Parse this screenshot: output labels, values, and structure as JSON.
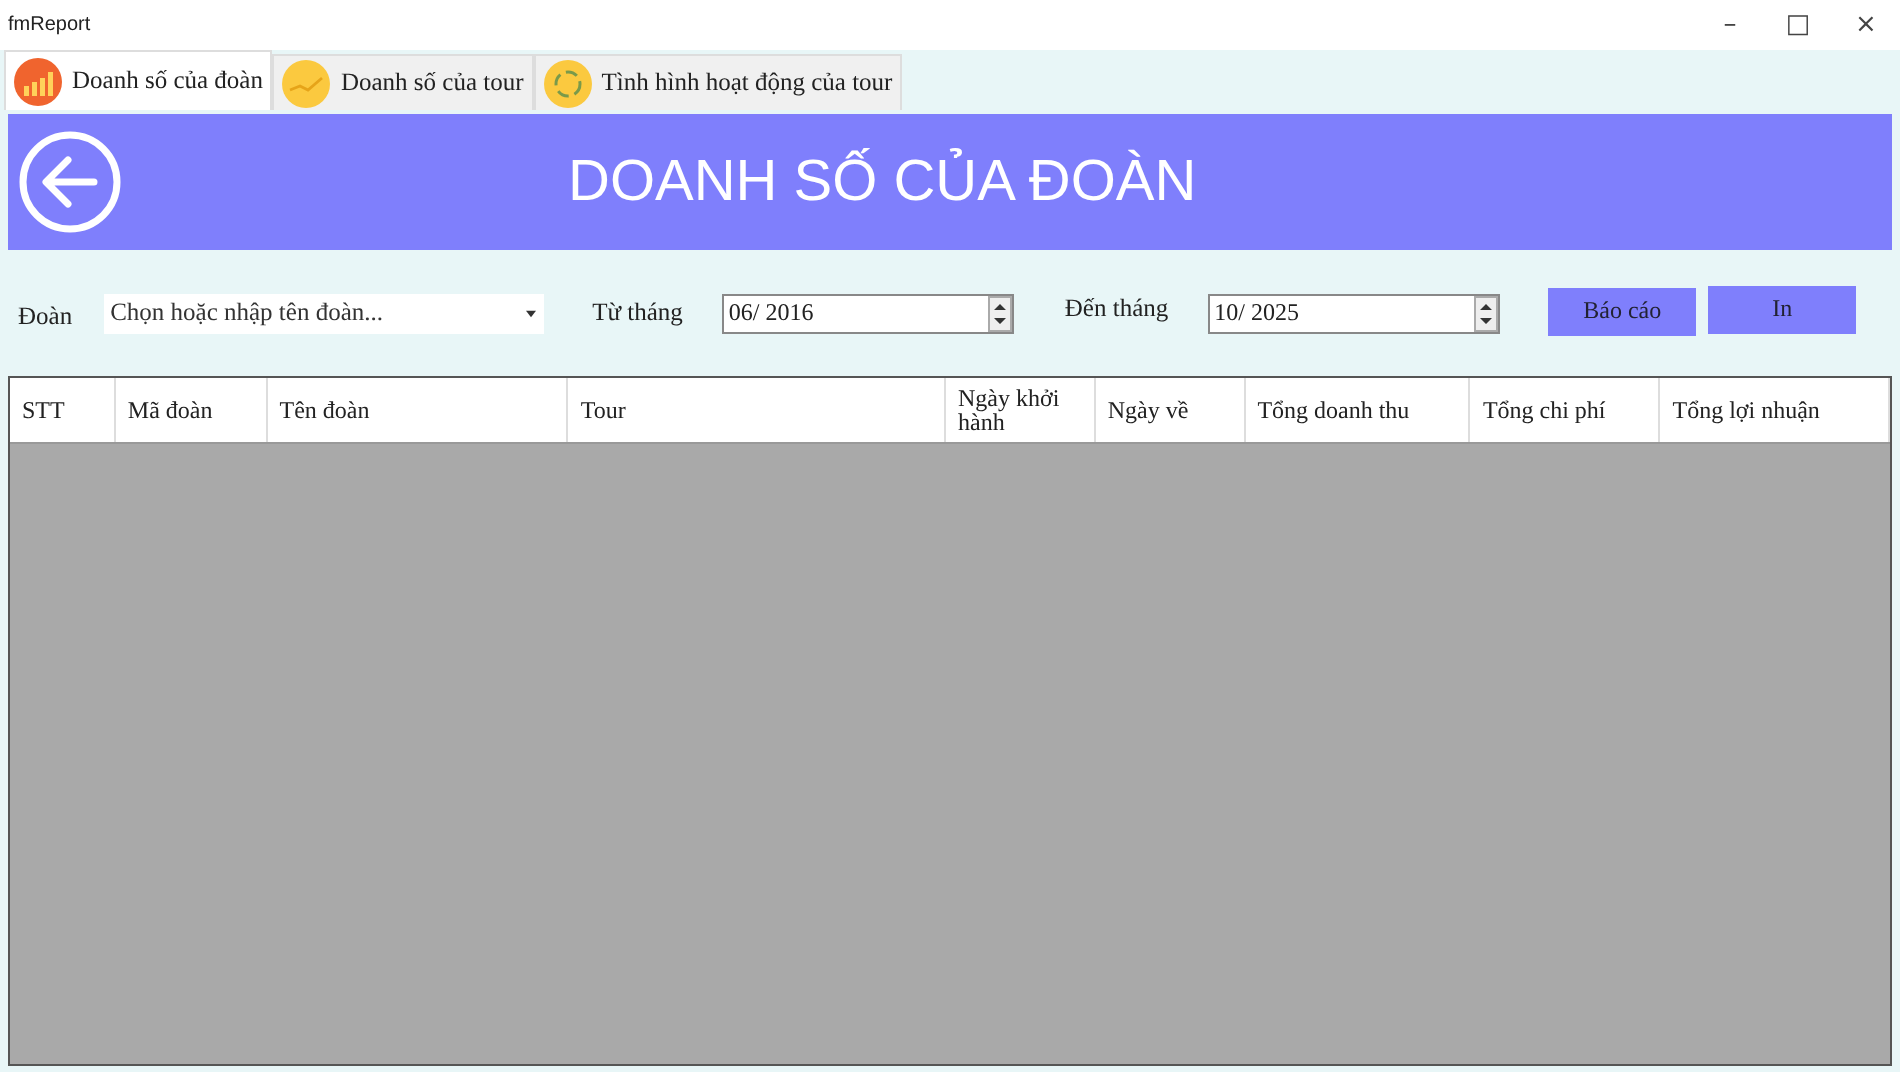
{
  "window": {
    "title": "fmReport",
    "controls": [
      "–",
      "□",
      "×"
    ]
  },
  "tabs": [
    {
      "label": "Doanh số của đoàn",
      "selected": true,
      "kind": "chart"
    },
    {
      "label": "Doanh số của tour",
      "selected": false,
      "kind": "line"
    },
    {
      "label": "Tình hình hoạt động của tour",
      "selected": false,
      "kind": "cycle"
    }
  ],
  "header": {
    "title": "DOANH SỐ CỦA ĐOÀN"
  },
  "filters": {
    "group_label": "Đoàn",
    "group_placeholder": "Chọn hoặc nhập tên đoàn...",
    "from_label": "Từ tháng",
    "from_value": "06/ 2016",
    "to_label": "Đến tháng",
    "to_value": "10/ 2025"
  },
  "buttons": [
    "Báo cáo",
    "In"
  ],
  "table": {
    "columns": [
      "STT",
      "Mã đoàn",
      "Tên đoàn",
      "Tour",
      "Ngày khởi hành",
      "Ngày về",
      "Tổng doanh thu",
      "Tổng chi phí",
      "Tổng lợi nhuận"
    ]
  }
}
